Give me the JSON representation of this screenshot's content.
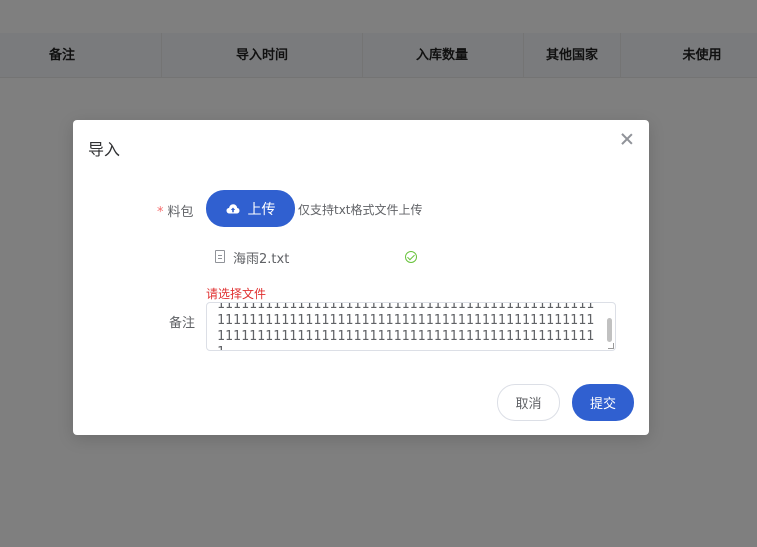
{
  "table": {
    "columns": [
      "备注",
      "导入时间",
      "入库数量",
      "其他国家",
      "未使用"
    ]
  },
  "dialog": {
    "title": "导入",
    "pack_label": "料包",
    "required_mark": "*",
    "upload_button": "上传",
    "upload_tip": "仅支持txt格式文件上传",
    "file_name": "海雨2.txt",
    "error_text": "请选择文件",
    "remark_label": "备注",
    "remark_value": "1111111111111111111111111111111111111111111111111111111111111111111111111111111111111111111111111111111111111111111111111111111111111111111111",
    "cancel_button": "取消",
    "submit_button": "提交"
  },
  "colors": {
    "primary": "#3060d0",
    "error": "#e03030",
    "success": "#67c23a"
  }
}
